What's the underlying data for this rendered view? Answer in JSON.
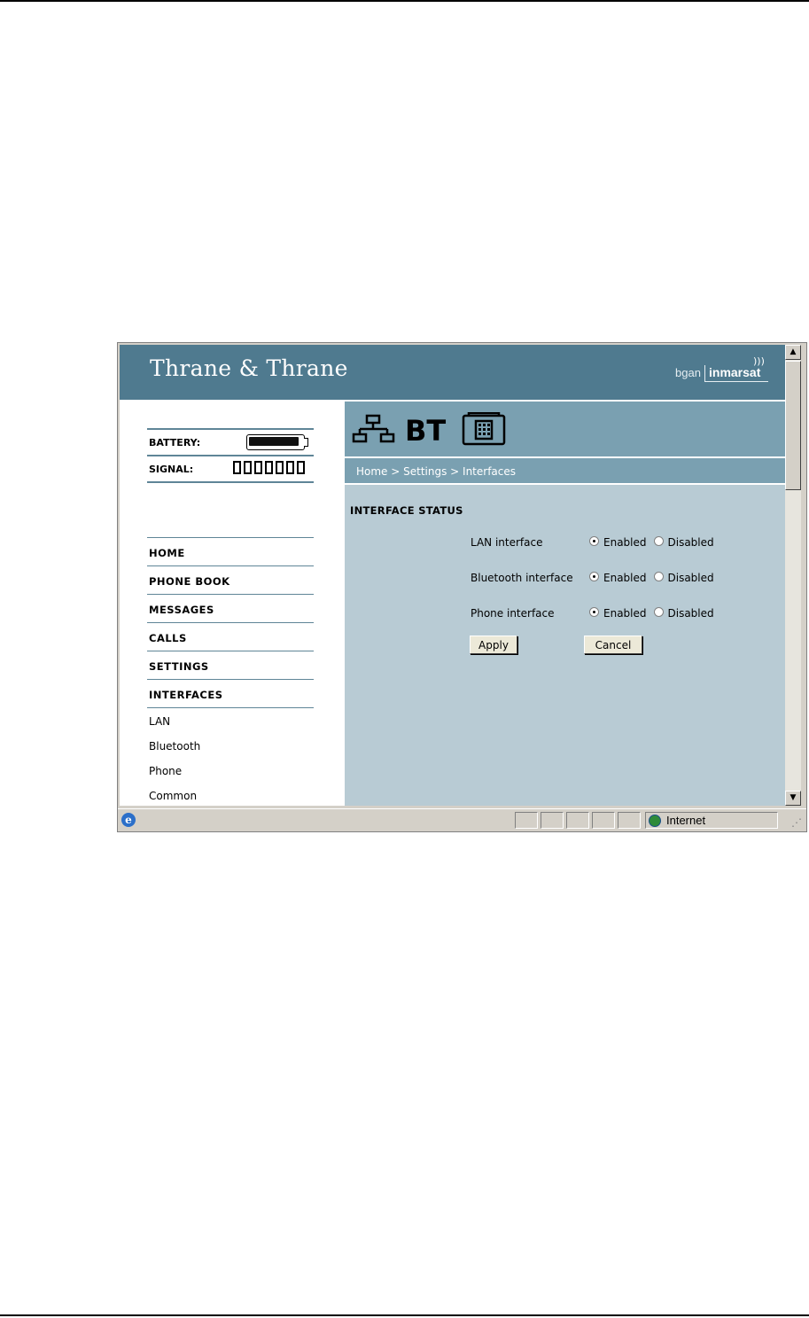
{
  "brand": {
    "name": "Thrane & Thrane",
    "partner_left": "bgan",
    "partner_right": "inmarsat"
  },
  "status": {
    "battery_label": "BATTERY:",
    "signal_label": "SIGNAL:",
    "signal_bars": 7
  },
  "nav": {
    "items": [
      "HOME",
      "PHONE BOOK",
      "MESSAGES",
      "CALLS",
      "SETTINGS",
      "INTERFACES"
    ],
    "sub_items": [
      "LAN",
      "Bluetooth",
      "Phone",
      "Common"
    ]
  },
  "iconbar": {
    "icons": [
      "lan-network-icon",
      "bluetooth-icon",
      "phone-icon"
    ],
    "bt_text": "BT"
  },
  "breadcrumb": "Home > Settings > Interfaces",
  "content": {
    "title": "INTERFACE STATUS",
    "rows": [
      {
        "label": "LAN interface",
        "enabled_label": "Enabled",
        "disabled_label": "Disabled",
        "selected": "Enabled"
      },
      {
        "label": "Bluetooth interface",
        "enabled_label": "Enabled",
        "disabled_label": "Disabled",
        "selected": "Enabled"
      },
      {
        "label": "Phone interface",
        "enabled_label": "Enabled",
        "disabled_label": "Disabled",
        "selected": "Enabled"
      }
    ],
    "apply_label": "Apply",
    "cancel_label": "Cancel"
  },
  "statusbar": {
    "zone": "Internet"
  },
  "colors": {
    "header": "#4f7a8f",
    "iconbar": "#7aa0b1",
    "content_bg": "#b8cbd4",
    "rule": "#5f8597"
  }
}
